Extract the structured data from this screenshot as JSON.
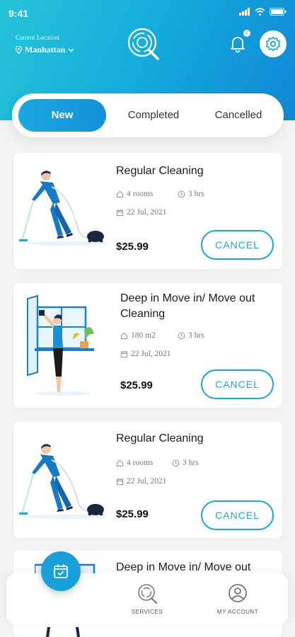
{
  "status_bar": {
    "time": "9:41"
  },
  "header": {
    "location_label": "Current Location",
    "location_value": "Manhattan",
    "notification_count": "2"
  },
  "tabs": [
    {
      "label": "New",
      "active": true
    },
    {
      "label": "Completed",
      "active": false
    },
    {
      "label": "Cancelled",
      "active": false
    }
  ],
  "bookings": [
    {
      "title": "Regular Cleaning",
      "size": "4 rooms",
      "duration": "3 hrs",
      "date": "22 Jul, 2021",
      "price": "$25.99",
      "action": "CANCEL"
    },
    {
      "title": "Deep in Move in/ Move out Cleaning",
      "size": "180 m2",
      "duration": "3 hrs",
      "date": "22 Jul, 2021",
      "price": "$25.99",
      "action": "CANCEL"
    },
    {
      "title": "Regular Cleaning",
      "size": "4 rooms",
      "duration": "3 hrs",
      "date": "22 Jul, 2021",
      "price": "$25.99",
      "action": "CANCEL"
    },
    {
      "title": "Deep in Move in/ Move out"
    }
  ],
  "bottom_nav": {
    "services_label": "SERVICES",
    "account_label": "MY ACCOUNT"
  },
  "colors": {
    "primary": "#17a0da",
    "header_start": "#27c3d9",
    "header_end": "#1088d6"
  },
  "icons": [
    "signal-icon",
    "wifi-icon",
    "battery-icon",
    "location-pin-icon",
    "chevron-down-icon",
    "bell-icon",
    "gear-icon",
    "home-icon",
    "clock-icon",
    "calendar-icon",
    "calendar-check-icon",
    "user-icon"
  ]
}
